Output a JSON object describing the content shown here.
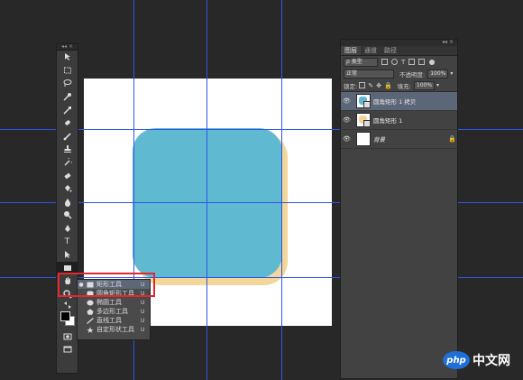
{
  "canvas": {
    "bg": "#ffffff",
    "shape_color": "#5fb9d1",
    "shadow_color": "#f3d79a",
    "guide_color": "#2f55e8"
  },
  "toolbox": {
    "header": "◂◂ ×",
    "tools": [
      "move-tool",
      "marquee-tool",
      "lasso-tool",
      "quick-select-tool",
      "eyedropper-tool",
      "spot-healing-tool",
      "brush-tool",
      "clone-stamp-tool",
      "history-brush-tool",
      "eraser-tool",
      "paint-bucket-tool",
      "blur-tool",
      "dodge-tool",
      "pen-tool",
      "type-tool",
      "path-select-tool",
      "rectangle-tool",
      "hand-tool",
      "zoom-tool"
    ],
    "type_glyph": "T"
  },
  "flyout": {
    "items": [
      {
        "label": "矩形工具",
        "key": "U",
        "icon": "rect-icon",
        "active": true
      },
      {
        "label": "圆角矩形工具",
        "key": "U",
        "icon": "rounded-rect-icon",
        "active": false
      },
      {
        "label": "椭圆工具",
        "key": "U",
        "icon": "ellipse-icon",
        "active": false
      },
      {
        "label": "多边形工具",
        "key": "U",
        "icon": "polygon-icon",
        "active": false
      },
      {
        "label": "直线工具",
        "key": "U",
        "icon": "line-icon",
        "active": false
      },
      {
        "label": "自定形状工具",
        "key": "U",
        "icon": "custom-shape-icon",
        "active": false
      }
    ],
    "highlight_color": "#e5262c"
  },
  "layers_panel": {
    "top_controls": "◂◂ ×",
    "tabs": [
      "图层",
      "通道",
      "路径"
    ],
    "filter_label": "ρ 类型",
    "blend_mode": "正常",
    "opacity_label": "不透明度:",
    "opacity_value": "100%",
    "lock_label": "锁定:",
    "fill_label": "填充:",
    "fill_value": "100%",
    "layers": [
      {
        "name": "圆角矩形 1 拷贝",
        "selected": true,
        "thumb": "#5fb9d1"
      },
      {
        "name": "圆角矩形 1",
        "selected": false,
        "thumb": "#f3d79a"
      },
      {
        "name": "背景",
        "selected": false,
        "thumb": "#ffffff",
        "locked": true
      }
    ]
  },
  "watermark": {
    "logo": "php",
    "text": "中文网"
  }
}
